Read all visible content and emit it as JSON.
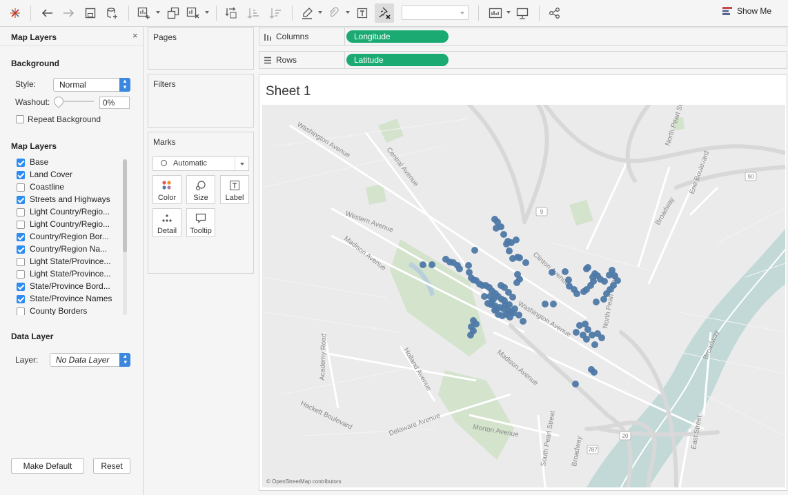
{
  "toolbar": {
    "show_me": "Show Me"
  },
  "left_panel": {
    "title": "Map Layers",
    "close": "×",
    "background": {
      "section": "Background",
      "style_label": "Style:",
      "style_value": "Normal",
      "washout_label": "Washout:",
      "washout_value": "0%",
      "repeat_label": "Repeat Background",
      "repeat_checked": false
    },
    "map_layers_section": "Map Layers",
    "layers": [
      {
        "label": "Base",
        "checked": true
      },
      {
        "label": "Land Cover",
        "checked": true
      },
      {
        "label": "Coastline",
        "checked": false
      },
      {
        "label": "Streets and Highways",
        "checked": true
      },
      {
        "label": "Light Country/Regio...",
        "checked": false
      },
      {
        "label": "Light Country/Regio...",
        "checked": false
      },
      {
        "label": "Country/Region Bor...",
        "checked": true
      },
      {
        "label": "Country/Region Na...",
        "checked": true
      },
      {
        "label": "Light State/Province...",
        "checked": false
      },
      {
        "label": "Light State/Province...",
        "checked": false
      },
      {
        "label": "State/Province Bord...",
        "checked": true
      },
      {
        "label": "State/Province Names",
        "checked": true
      },
      {
        "label": "County Borders",
        "checked": false
      }
    ],
    "data_layer": {
      "section": "Data Layer",
      "layer_label": "Layer:",
      "layer_value": "No Data Layer"
    },
    "make_default": "Make Default",
    "reset": "Reset"
  },
  "cards": {
    "pages": "Pages",
    "filters": "Filters",
    "marks": "Marks",
    "mark_type": "Automatic",
    "buttons": [
      "Color",
      "Size",
      "Label",
      "Detail",
      "Tooltip"
    ]
  },
  "shelves": {
    "columns_label": "Columns",
    "columns_pill": "Longitude",
    "rows_label": "Rows",
    "rows_pill": "Latitude"
  },
  "sheet": {
    "title": "Sheet 1",
    "attribution": "© OpenStreetMap contributors",
    "point_color": "#4e79a7",
    "street_labels": [
      "Washington Avenue",
      "Central Avenue",
      "Western Avenue",
      "Madison Avenue",
      "Clinton Avenue",
      "Washington Avenue",
      "Madison Avenue",
      "North Pearl Street",
      "Broadway",
      "Erie Boulevard",
      "Holland Avenue",
      "Academy Road",
      "Hackett Boulevard",
      "Delaware Avenue",
      "Morton Avenue",
      "Broadway",
      "East Street",
      "Broadway",
      "South Pearl Street",
      "North Pearl Street"
    ],
    "road_shields": [
      "9",
      "90",
      "20",
      "787"
    ]
  }
}
